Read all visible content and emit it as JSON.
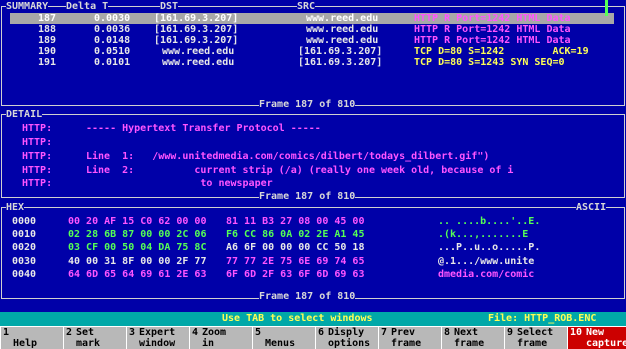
{
  "summary": {
    "title": "SUMMARY",
    "columns": [
      "Delta T",
      "DST",
      "SRC"
    ],
    "rows": [
      {
        "id": "187",
        "delta": "0.0030",
        "dst": "[161.69.3.207]",
        "src": "www.reed.edu",
        "info": "HTTP R Port=1242 HTML Data",
        "selected": true
      },
      {
        "id": "188",
        "delta": "0.0036",
        "dst": "[161.69.3.207]",
        "src": "www.reed.edu",
        "info": "HTTP R Port=1242 HTML Data",
        "selected": false
      },
      {
        "id": "189",
        "delta": "0.0148",
        "dst": "[161.69.3.207]",
        "src": "www.reed.edu",
        "info": "HTTP R Port=1242 HTML Data",
        "selected": false
      },
      {
        "id": "190",
        "delta": "0.0510",
        "dst": "www.reed.edu",
        "src": "[161.69.3.207]",
        "info": "TCP D=80 S=1242        ACK=19",
        "selected": false
      },
      {
        "id": "191",
        "delta": "0.0101",
        "dst": "www.reed.edu",
        "src": "[161.69.3.207]",
        "info": "TCP D=80 S=1243 SYN SEQ=0",
        "selected": false
      }
    ],
    "footer": "Frame 187 of 810"
  },
  "detail": {
    "title": "DETAIL",
    "lines": [
      {
        "prefix": "HTTP:",
        "text": "----- Hypertext Transfer Protocol -----"
      },
      {
        "prefix": "HTTP:",
        "text": ""
      },
      {
        "prefix": "HTTP:",
        "text": "Line  1:   /www.unitedmedia.com/comics/dilbert/todays_dilbert.gif\")"
      },
      {
        "prefix": "HTTP:",
        "text": "Line  2:          current strip (/a) (really one week old, because of i"
      },
      {
        "prefix": "HTTP:",
        "text": "                   to newspaper"
      }
    ],
    "footer": "Frame 187 of 810"
  },
  "hex": {
    "title": "HEX",
    "ascii_title": "ASCII",
    "rows": [
      {
        "addr": "0000",
        "bytes1": "00 20 AF 15 C0 62 00 00",
        "bytes2": "81 11 B3 27 08 00 45 00",
        "ascii": ".. ....b....'..E."
      },
      {
        "addr": "0010",
        "bytes1": "02 28 6B 87 00 00 2C 06",
        "bytes2": "F6 CC 86 0A 02 2E A1 45",
        "ascii": ".(k...,.......E"
      },
      {
        "addr": "0020",
        "bytes1": "03 CF 00 50 04 DA 75 8C",
        "bytes2": "A6 6F 00 00 00 CC 50 18",
        "ascii": "...P..u..o.....P."
      },
      {
        "addr": "0030",
        "bytes1": "40 00 31 8F 00 00 2F 77",
        "bytes2": "77 77 2E 75 6E 69 74 65",
        "ascii": "@.1.../www.unite"
      },
      {
        "addr": "0040",
        "bytes1": "64 6D 65 64 69 61 2E 63",
        "bytes2": "6F 6D 2F 63 6F 6D 69 63",
        "ascii": "dmedia.com/comic"
      }
    ],
    "footer": "Frame 187 of 810"
  },
  "status": {
    "hint": "Use TAB to select windows",
    "file": "File: HTTP_ROB.ENC"
  },
  "fkeys": [
    {
      "n": "1",
      "a": "",
      "b": "Help"
    },
    {
      "n": "2",
      "a": "Set",
      "b": "mark"
    },
    {
      "n": "3",
      "a": "Expert",
      "b": "window"
    },
    {
      "n": "4",
      "a": "Zoom",
      "b": "in"
    },
    {
      "n": "5",
      "a": "",
      "b": "Menus"
    },
    {
      "n": "6",
      "a": "Disply",
      "b": "options"
    },
    {
      "n": "7",
      "a": "Prev",
      "b": "frame"
    },
    {
      "n": "8",
      "a": "Next",
      "b": "frame"
    },
    {
      "n": "9",
      "a": "Select",
      "b": "frame"
    },
    {
      "n": "10",
      "a": "New",
      "b": "capture"
    }
  ]
}
